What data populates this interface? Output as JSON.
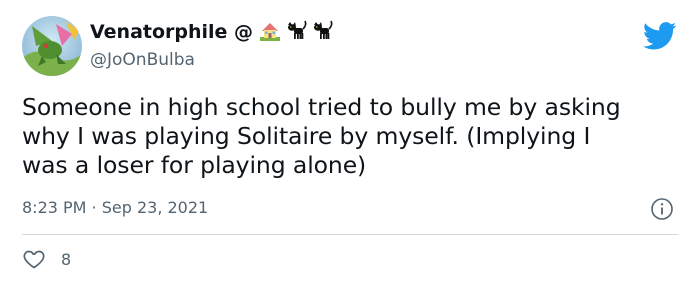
{
  "author": {
    "display_name": "Venatorphile @",
    "handle": "@JoOnBulba",
    "name_emojis": [
      "house-emoji",
      "black-cat-emoji",
      "black-cat-emoji"
    ]
  },
  "tweet": {
    "text": "Someone in high school tried to bully me by asking\nwhy I was playing Solitaire by myself. (Implying I\nwas a loser for playing alone)",
    "timestamp": "8:23 PM · Sep 23, 2021",
    "like_count": "8"
  },
  "icons": {
    "brand": "twitter-bird-icon",
    "info": "info-icon",
    "like": "heart-icon"
  },
  "colors": {
    "brand_blue": "#1d9bf0",
    "text_primary": "#0f1419",
    "text_secondary": "#536471",
    "divider": "#cfd9de"
  }
}
